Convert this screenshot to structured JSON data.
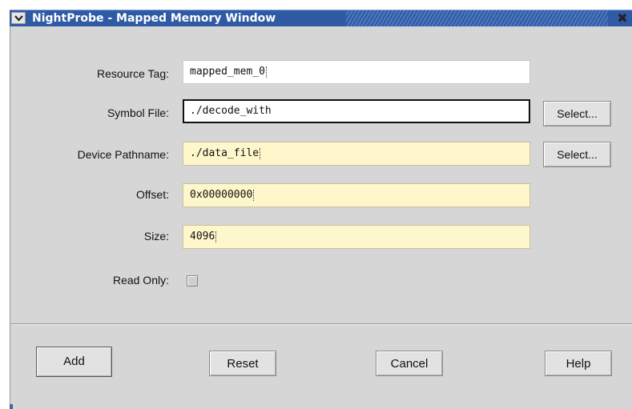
{
  "window": {
    "title": "NightProbe - Mapped Memory Window",
    "close_glyph": "✖"
  },
  "form": {
    "resource_tag": {
      "label": "Resource Tag:",
      "value": "mapped_mem_0"
    },
    "symbol_file": {
      "label": "Symbol File:",
      "value": "./decode_with",
      "select_label": "Select..."
    },
    "device_pathname": {
      "label": "Device Pathname:",
      "value": "./data_file",
      "select_label": "Select..."
    },
    "offset": {
      "label": "Offset:",
      "value": "0x00000000"
    },
    "size": {
      "label": "Size:",
      "value": "4096"
    },
    "read_only": {
      "label": "Read Only:",
      "checked": false
    }
  },
  "buttons": {
    "add": "Add",
    "reset": "Reset",
    "cancel": "Cancel",
    "help": "Help"
  },
  "colors": {
    "titlebar": "#2f5aa4",
    "dialog_bg": "#d6d6d6",
    "field_highlight": "#fff7cc"
  }
}
